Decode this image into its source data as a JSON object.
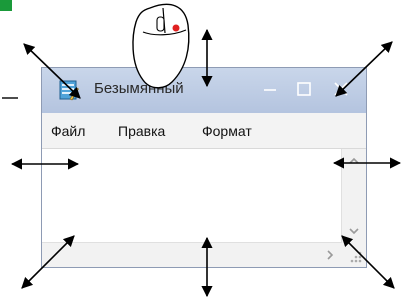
{
  "window": {
    "title": "Безымянный",
    "menu": [
      "Файл",
      "Правка",
      "Формат"
    ]
  },
  "icons": {
    "app": "notepad-icon",
    "minimize": "minimize-icon",
    "maximize": "maximize-icon",
    "close": "close-icon",
    "mouse": "mouse-icon",
    "scroll_up": "chevron-up-icon",
    "scroll_down": "chevron-down-icon",
    "scroll_right": "chevron-right-icon",
    "resize_arrows": "double-headed-arrow-icon"
  },
  "colors": {
    "titlebar": "#b8c7e0",
    "menubar": "#f3f3f3",
    "border": "#8e9bb4",
    "arrows": "#000000",
    "mouse_button": "#e02020"
  }
}
